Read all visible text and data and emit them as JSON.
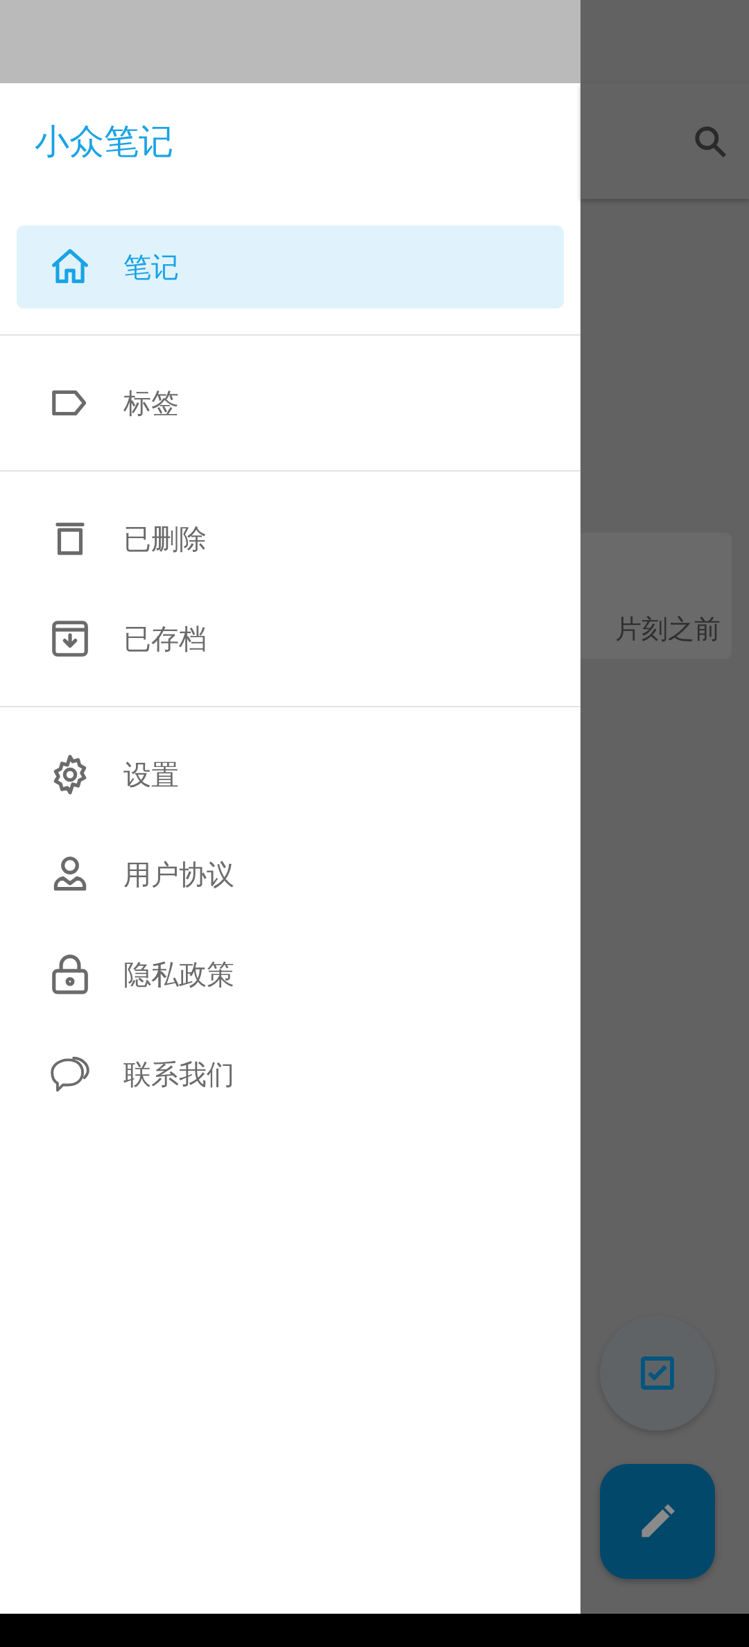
{
  "drawer": {
    "title": "小众笔记",
    "sections": [
      {
        "items": [
          {
            "label": "笔记",
            "selected": true
          }
        ]
      },
      {
        "items": [
          {
            "label": "标签",
            "selected": false
          }
        ]
      },
      {
        "items": [
          {
            "label": "已删除",
            "selected": false
          },
          {
            "label": "已存档",
            "selected": false
          }
        ]
      },
      {
        "items": [
          {
            "label": "设置",
            "selected": false
          },
          {
            "label": "用户协议",
            "selected": false
          },
          {
            "label": "隐私政策",
            "selected": false
          },
          {
            "label": "联系我们",
            "selected": false
          }
        ]
      }
    ]
  },
  "background": {
    "note_card": {
      "time": "片刻之前"
    }
  }
}
